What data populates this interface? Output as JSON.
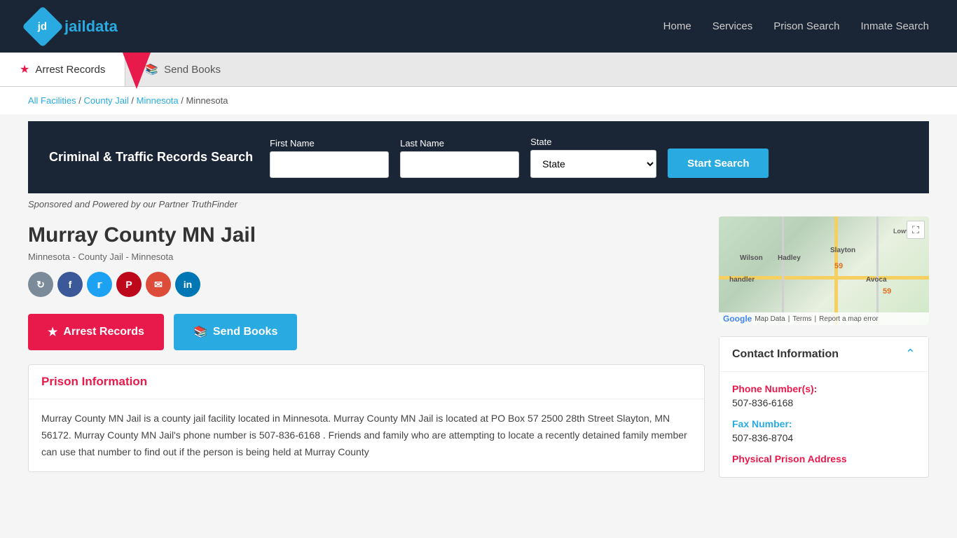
{
  "header": {
    "logo_text": "jaildata",
    "logo_abbr": "jd",
    "nav": [
      {
        "label": "Home",
        "href": "#"
      },
      {
        "label": "Services",
        "href": "#"
      },
      {
        "label": "Prison Search",
        "href": "#"
      },
      {
        "label": "Inmate Search",
        "href": "#"
      }
    ]
  },
  "tabs": [
    {
      "label": "Arrest Records",
      "icon": "star",
      "active": true
    },
    {
      "label": "Send Books",
      "icon": "book",
      "active": false
    }
  ],
  "breadcrumb": {
    "items": [
      {
        "label": "All Facilities",
        "href": "#"
      },
      {
        "label": "County Jail",
        "href": "#"
      },
      {
        "label": "Minnesota",
        "href": "#"
      },
      {
        "label": "Minnesota",
        "href": null
      }
    ]
  },
  "search": {
    "title": "Criminal & Traffic Records Search",
    "first_name_label": "First Name",
    "first_name_placeholder": "",
    "last_name_label": "Last Name",
    "last_name_placeholder": "",
    "state_label": "State",
    "state_default": "State",
    "start_search_label": "Start Search",
    "sponsored_text": "Sponsored and Powered by our Partner TruthFinder"
  },
  "facility": {
    "title": "Murray County MN Jail",
    "subtitle": "Minnesota - County Jail - Minnesota",
    "social_buttons": [
      {
        "label": "Share",
        "icon": "share",
        "class": "social-share"
      },
      {
        "label": "Facebook",
        "icon": "f",
        "class": "social-fb"
      },
      {
        "label": "Twitter",
        "icon": "t",
        "class": "social-tw"
      },
      {
        "label": "Pinterest",
        "icon": "p",
        "class": "social-pin"
      },
      {
        "label": "Email",
        "icon": "@",
        "class": "social-em"
      },
      {
        "label": "LinkedIn",
        "icon": "in",
        "class": "social-li"
      }
    ],
    "arrest_records_label": "Arrest Records",
    "send_books_label": "Send Books",
    "prison_info_header": "Prison Information",
    "prison_info_text": "Murray County MN Jail is a county jail facility located in Minnesota. Murray County MN Jail is located at PO Box 57 2500 28th Street Slayton, MN 56172. Murray County MN Jail's phone number is 507-836-6168 . Friends and family who are attempting to locate a recently detained family member can use that number to find out if the person is being held at Murray County"
  },
  "contact": {
    "header": "Contact Information",
    "phone_label": "Phone Number(s):",
    "phone_value": "507-836-6168",
    "fax_label": "Fax Number:",
    "fax_value": "507-836-8704",
    "physical_label": "Physical Prison Address"
  },
  "map": {
    "footer_terms": "Terms",
    "footer_map_data": "Map Data",
    "footer_report": "Report a map error"
  }
}
